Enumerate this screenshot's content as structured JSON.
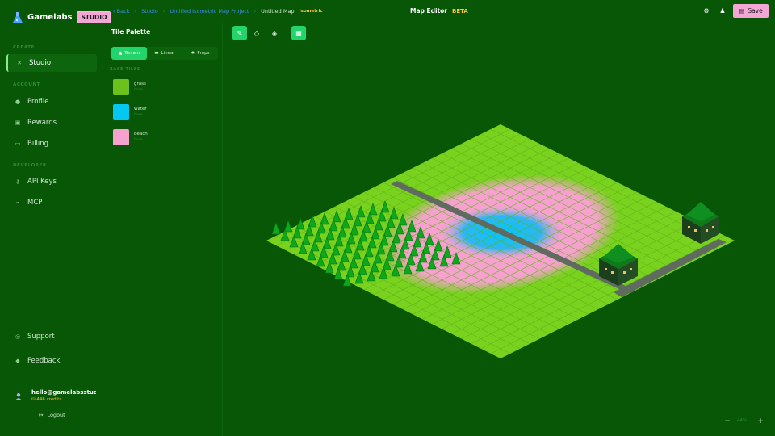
{
  "brand": {
    "name": "Gamelabs",
    "badge": "STUDIO"
  },
  "sidebar": {
    "sections": [
      {
        "label": "CREATE"
      },
      {
        "label": "ACCOUNT"
      },
      {
        "label": "DEVELOPER"
      }
    ],
    "items": [
      {
        "label": "Studio",
        "icon": "wand-icon",
        "active": true
      },
      {
        "label": "Profile",
        "icon": "user-icon"
      },
      {
        "label": "Rewards",
        "icon": "gift-icon"
      },
      {
        "label": "Billing",
        "icon": "card-icon"
      },
      {
        "label": "API Keys",
        "icon": "key-icon"
      },
      {
        "label": "MCP",
        "icon": "plug-icon"
      },
      {
        "label": "Support",
        "icon": "lifebuoy-icon"
      },
      {
        "label": "Feedback",
        "icon": "chat-icon"
      }
    ]
  },
  "user": {
    "email": "hello@gamelabsstudi...",
    "credits": "446 credits",
    "logout": "Logout"
  },
  "breadcrumb": {
    "back": "Back",
    "studio": "Studio",
    "project": "Untitled Isometric Map Project",
    "current": "Untitled Map",
    "tag": "Isometric"
  },
  "header": {
    "title": "Map Editor",
    "beta": "BETA",
    "save": "Save"
  },
  "palette": {
    "title": "Tile Palette",
    "tabs": [
      {
        "label": "Terrain"
      },
      {
        "label": "Linear"
      },
      {
        "label": "Props"
      }
    ],
    "section": "BASE TILES",
    "tiles": [
      {
        "name": "grass",
        "sub": "base",
        "color": "#6cc11c"
      },
      {
        "name": "water",
        "sub": "base",
        "color": "#05c8f2"
      },
      {
        "name": "beach",
        "sub": "base",
        "color": "#f7a1cf"
      }
    ]
  },
  "zoom": {
    "level": "44%"
  },
  "colors": {
    "background": "#075707",
    "grass": "#79d21e",
    "accent": "#22d46b",
    "save": "#f4a6d7"
  }
}
